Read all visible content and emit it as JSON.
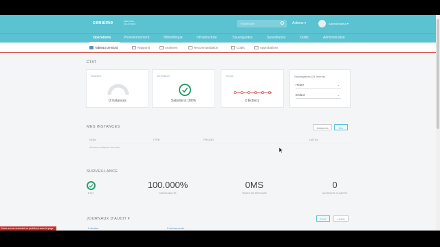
{
  "header": {
    "logo": "cenaime",
    "logo_sub_line1": "SERVICES",
    "logo_sub_line2": "SOLUTIONS",
    "search_placeholder": "Rechercher",
    "actions_label": "Actions ▾",
    "username": "Administrateur ▾"
  },
  "nav": {
    "items": [
      {
        "label": "Opérations"
      },
      {
        "label": "Provisionnement"
      },
      {
        "label": "Bibliothèque"
      },
      {
        "label": "Infrastructure"
      },
      {
        "label": "Sauvegardes"
      },
      {
        "label": "Surveillance"
      },
      {
        "label": "Outils"
      },
      {
        "label": "Administration"
      }
    ]
  },
  "subnav": {
    "items": [
      {
        "label": "Tableau De Bord"
      },
      {
        "label": "Rapports"
      },
      {
        "label": "Analyses"
      },
      {
        "label": "Recommandation"
      },
      {
        "label": "Coûts"
      },
      {
        "label": "Approbations"
      }
    ]
  },
  "etat": {
    "title": "ÉTAT",
    "cards": [
      {
        "title": "Instances",
        "caption": "0 Instances"
      },
      {
        "title": "Surveillance",
        "caption": "Satisfait à 100%"
      },
      {
        "title": "Tâches",
        "caption": "0 Échecs"
      },
      {
        "title": "Sauvegardes (24 heures)"
      }
    ],
    "filter": {
      "period": "Heure",
      "group": "Enfant"
    }
  },
  "instances": {
    "title": "MES INSTANCES",
    "buttons": [
      "Instances",
      "Moi"
    ],
    "columns": [
      "NOM",
      "TYPE",
      "PROJET",
      "DATES"
    ],
    "empty": "Aucune instance trouvée"
  },
  "monitoring": {
    "title": "SURVEILLANCE",
    "stats": [
      {
        "value": "",
        "label": "ÉTAT"
      },
      {
        "value": "100.000%",
        "label": "DISPONIBILITÉ"
      },
      {
        "value": "0MS",
        "label": "TEMPS DE RÉPONSE"
      },
      {
        "value": "0",
        "label": "INCIDENTS OUVERTS"
      }
    ]
  },
  "journal": {
    "title": "JOURNAUX D'AUDIT ▾",
    "buttons": [
      "ÉTAT",
      "LOGS"
    ],
    "row_a": "0 alertes",
    "row_b": "0 événements"
  },
  "toast": "Nous avons rencontré un problème avec la page"
}
